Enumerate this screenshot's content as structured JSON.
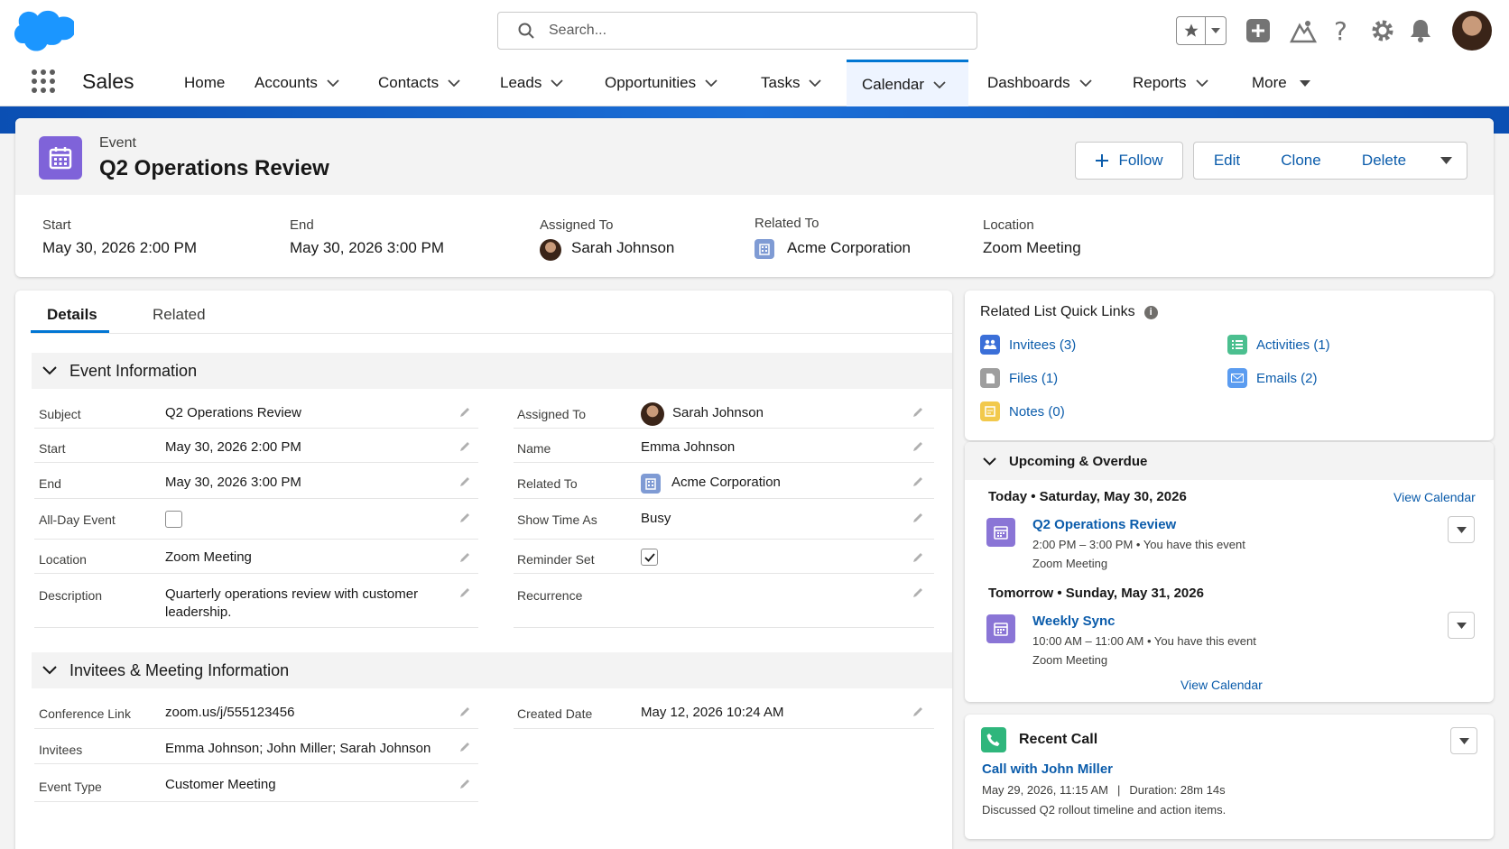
{
  "header": {
    "search_placeholder": "Search...",
    "app_name": "Sales",
    "nav": [
      {
        "label": "Home"
      },
      {
        "label": "Accounts"
      },
      {
        "label": "Contacts"
      },
      {
        "label": "Leads"
      },
      {
        "label": "Opportunities"
      },
      {
        "label": "Tasks"
      },
      {
        "label": "Calendar",
        "active": true
      },
      {
        "label": "Dashboards"
      },
      {
        "label": "Reports"
      },
      {
        "label": "More"
      }
    ]
  },
  "record": {
    "object_label": "Event",
    "title": "Q2 Operations Review",
    "actions": {
      "follow": "Follow",
      "edit": "Edit",
      "clone": "Clone",
      "delete": "Delete"
    },
    "highlights": {
      "start_label": "Start",
      "start_value": "May 30, 2026 2:00 PM",
      "end_label": "End",
      "end_value": "May 30, 2026 3:00 PM",
      "assigned_label": "Assigned To",
      "assigned_value": "Sarah Johnson",
      "related_label": "Related To",
      "related_value": "Acme Corporation",
      "location_label": "Location",
      "location_value": "Zoom Meeting"
    }
  },
  "tabs": {
    "details": "Details",
    "related": "Related"
  },
  "event_info": {
    "title": "Event Information",
    "left": [
      {
        "label": "Subject",
        "value": "Q2 Operations Review"
      },
      {
        "label": "Start",
        "value": "May 30, 2026 2:00 PM"
      },
      {
        "label": "End",
        "value": "May 30, 2026 3:00 PM"
      },
      {
        "label": "All-Day Event",
        "value": ""
      },
      {
        "label": "Location",
        "value": "Zoom Meeting"
      },
      {
        "label": "Description",
        "value": "Quarterly operations review with customer leadership."
      }
    ],
    "right": [
      {
        "label": "Assigned To",
        "value": "Sarah Johnson"
      },
      {
        "label": "Name",
        "value": "Emma Johnson"
      },
      {
        "label": "Related To",
        "value": "Acme Corporation"
      },
      {
        "label": "Show Time As",
        "value": "Busy"
      },
      {
        "label": "Reminder Set",
        "value": ""
      },
      {
        "label": "Recurrence",
        "value": ""
      }
    ],
    "all_day_checked": false,
    "reminder_checked": true
  },
  "invitees_info": {
    "title": "Invitees & Meeting Information",
    "left": [
      {
        "label": "Conference Link",
        "value": "zoom.us/j/555123456"
      },
      {
        "label": "Invitees",
        "value": "Emma Johnson; John Miller; Sarah Johnson"
      },
      {
        "label": "Event Type",
        "value": "Customer Meeting"
      }
    ],
    "right": [
      {
        "label": "Created Date",
        "value": "May 12, 2026 10:24 AM"
      }
    ]
  },
  "quick_links": {
    "title": "Related List Quick Links",
    "items": [
      {
        "label": "Invitees (3)",
        "color": "#3b6fd8"
      },
      {
        "label": "Activities (1)",
        "color": "#4bbf8f"
      },
      {
        "label": "Files (1)",
        "color": "#9e9e9e"
      },
      {
        "label": "Emails (2)",
        "color": "#5b9cf0"
      },
      {
        "label": "Notes (0)",
        "color": "#f2c94c"
      }
    ]
  },
  "upcoming": {
    "title": "Upcoming & Overdue",
    "view_calendar_top": "View Calendar",
    "today_label": "Today • Saturday, May 30, 2026",
    "tomorrow_label": "Tomorrow • Sunday, May 31, 2026",
    "events": [
      {
        "title": "Q2 Operations Review",
        "time": "2:00 PM – 3:00 PM • You have this event",
        "location": "Zoom Meeting"
      },
      {
        "title": "Weekly Sync",
        "time": "10:00 AM – 11:00 AM • You have this event",
        "location": "Zoom Meeting"
      }
    ],
    "view_calendar_bottom": "View Calendar"
  },
  "recent_call": {
    "title": "Recent Call",
    "call_title": "Call with John Miller",
    "meta_date": "May 29, 2026, 11:15 AM",
    "meta_sep": "|",
    "meta_duration": "Duration: 28m 14s",
    "summary": "Discussed Q2 rollout timeline and action items."
  },
  "colors": {
    "accent": "#0b5cab",
    "event_icon": "#7f63d9",
    "brand_cloud": "#1b96ff"
  }
}
